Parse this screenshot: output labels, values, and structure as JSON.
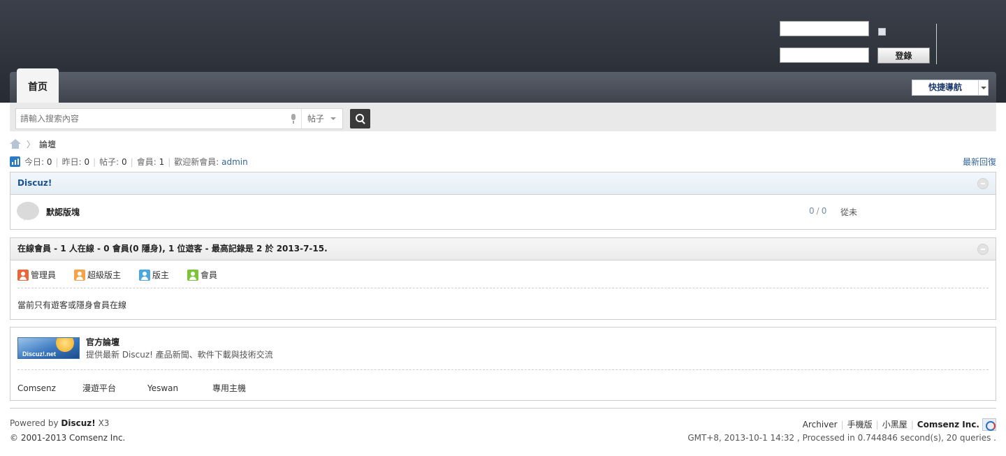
{
  "header": {
    "username_placeholder": "",
    "password_placeholder": "",
    "login_label": "登錄"
  },
  "nav": {
    "home_label": "首页",
    "quick_nav_label": "快捷導航"
  },
  "search": {
    "placeholder": "請輸入搜索內容",
    "type_label": "帖子"
  },
  "breadcrumb": {
    "current": "論壇"
  },
  "stats": {
    "today_label": "今日:",
    "today_value": "0",
    "yesterday_label": "昨日:",
    "yesterday_value": "0",
    "posts_label": "帖子:",
    "posts_value": "0",
    "members_label": "會員:",
    "members_value": "1",
    "welcome_label": "歡迎新會員:",
    "welcome_user": "admin",
    "latest_reply": "最新回復"
  },
  "forum_group": {
    "title": "Discuz!",
    "forums": [
      {
        "name": "默認版塊",
        "threads": "0",
        "posts": "0",
        "last_post": "從未"
      }
    ]
  },
  "online": {
    "title": "在線會員 - 1 人在線 - 0 會員(0 隱身), 1 位遊客 - 最高記錄是 2 於 2013-7-15.",
    "legend": [
      {
        "label": "管理員",
        "color": "#e8683a"
      },
      {
        "label": "超級版主",
        "color": "#f3a44a"
      },
      {
        "label": "版主",
        "color": "#4aa8e0"
      },
      {
        "label": "會員",
        "color": "#7cc43a"
      }
    ],
    "message": "當前只有遊客或隱身會員在線"
  },
  "links": {
    "logo_text": "Discuz!.net",
    "featured_title": "官方論壇",
    "featured_desc": "提供最新 Discuz! 產品新聞、軟件下載與技術交流",
    "items": [
      "Comsenz",
      "漫遊平台",
      "Yeswan",
      "專用主機"
    ]
  },
  "footer": {
    "powered_by": "Powered by",
    "product": "Discuz!",
    "version": "X3",
    "copyright": "© 2001-2013 Comsenz Inc.",
    "links": [
      "Archiver",
      "手機版",
      "小黑屋"
    ],
    "company": "Comsenz Inc.",
    "debug": "GMT+8, 2013-10-1 14:32 , Processed in 0.744846 second(s), 20 queries ."
  }
}
